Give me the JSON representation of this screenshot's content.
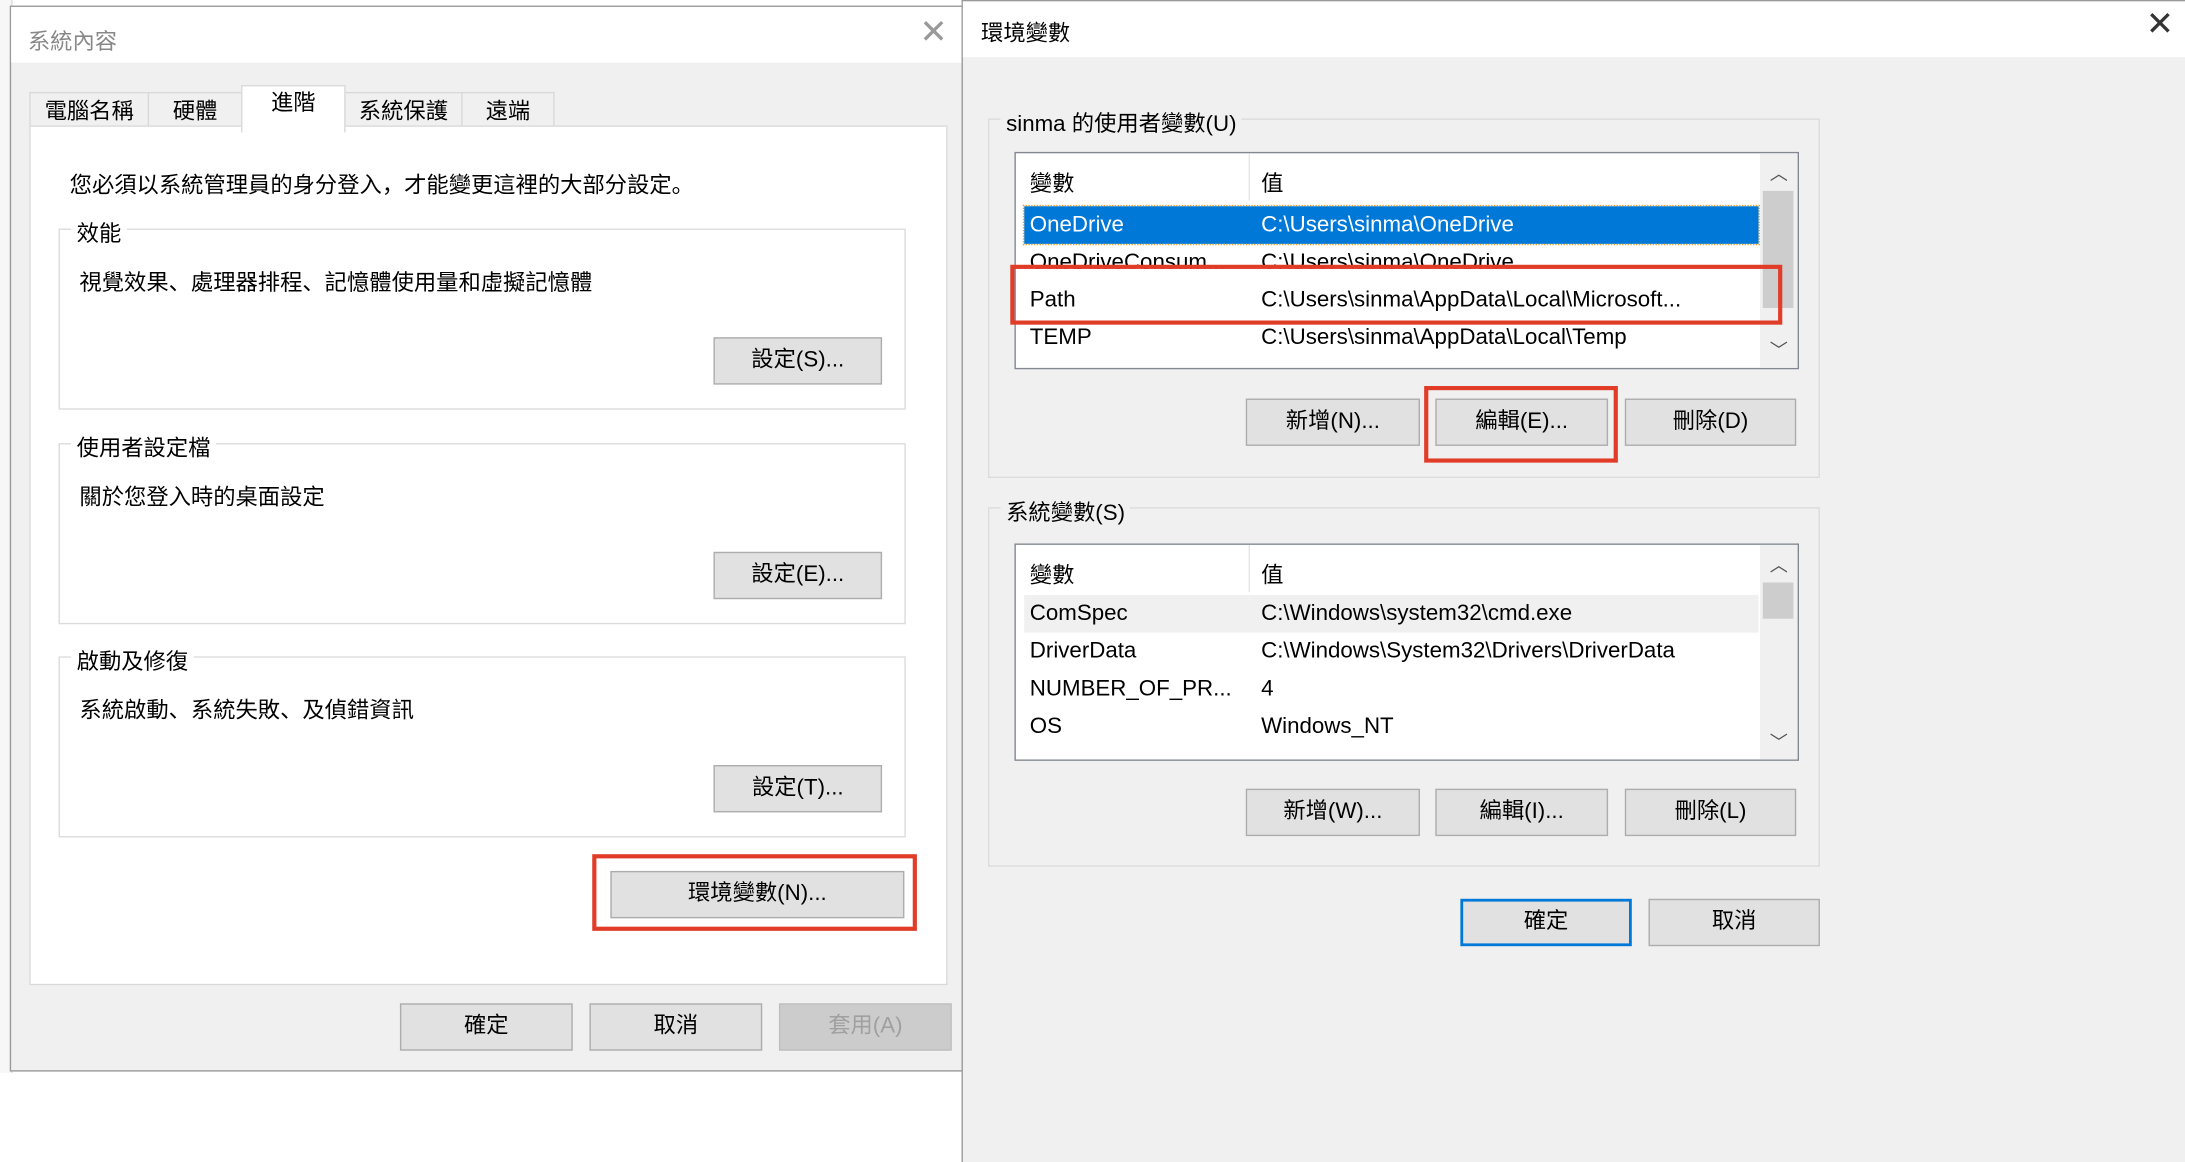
{
  "system_properties": {
    "title": "系統內容",
    "tabs": [
      "電腦名稱",
      "硬體",
      "進階",
      "系統保護",
      "遠端"
    ],
    "selected_tab": "進階",
    "admin_note": "您必須以系統管理員的身分登入，才能變更這裡的大部分設定。",
    "performance": {
      "label": "效能",
      "desc": "視覺效果、處理器排程、記憶體使用量和虛擬記憶體",
      "button": "設定(S)..."
    },
    "user_profiles": {
      "label": "使用者設定檔",
      "desc": "關於您登入時的桌面設定",
      "button": "設定(E)..."
    },
    "startup_recovery": {
      "label": "啟動及修復",
      "desc": "系統啟動、系統失敗、及偵錯資訊",
      "button": "設定(T)..."
    },
    "env_button": "環境變數(N)...",
    "ok": "確定",
    "cancel": "取消",
    "apply": "套用(A)"
  },
  "env_vars": {
    "title": "環境變數",
    "user_group": "sinma 的使用者變數(U)",
    "col_var": "變數",
    "col_val": "值",
    "user_rows": [
      {
        "name": "OneDrive",
        "value": "C:\\Users\\sinma\\OneDrive"
      },
      {
        "name": "OneDriveConsum...",
        "value": "C:\\Users\\sinma\\OneDrive"
      },
      {
        "name": "Path",
        "value": "C:\\Users\\sinma\\AppData\\Local\\Microsoft..."
      },
      {
        "name": "TEMP",
        "value": "C:\\Users\\sinma\\AppData\\Local\\Temp"
      }
    ],
    "user_buttons": {
      "new": "新增(N)...",
      "edit": "編輯(E)...",
      "delete": "刪除(D)"
    },
    "system_group": "系統變數(S)",
    "system_rows": [
      {
        "name": "ComSpec",
        "value": "C:\\Windows\\system32\\cmd.exe"
      },
      {
        "name": "DriverData",
        "value": "C:\\Windows\\System32\\Drivers\\DriverData"
      },
      {
        "name": "NUMBER_OF_PR...",
        "value": "4"
      },
      {
        "name": "OS",
        "value": "Windows_NT"
      }
    ],
    "system_buttons": {
      "new": "新增(W)...",
      "edit": "編輯(I)...",
      "delete": "刪除(L)"
    },
    "ok": "確定",
    "cancel": "取消"
  },
  "colors": {
    "selection": "#0078d7",
    "highlight": "#e03c28"
  }
}
